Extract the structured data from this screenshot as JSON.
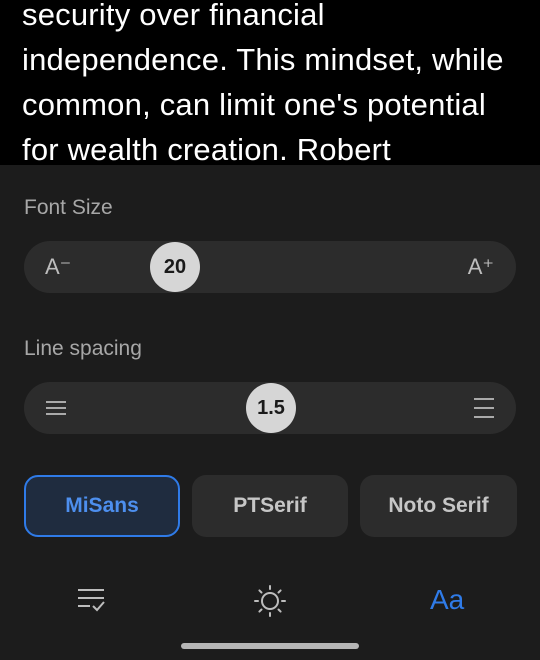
{
  "reader": {
    "lines": [
      "security over financial",
      "independence. This mindset, while",
      "common, can limit one's potential",
      "for wealth creation. Robert"
    ]
  },
  "font_size": {
    "label": "Font Size",
    "decrease_label": "A⁻",
    "increase_label": "A⁺",
    "value": "20"
  },
  "line_spacing": {
    "label": "Line spacing",
    "value": "1.5"
  },
  "fonts": {
    "options": [
      "MiSans",
      "PTSerif",
      "Noto Serif"
    ],
    "selected": "MiSans"
  },
  "bottom_nav": {
    "items": [
      {
        "icon": "table-of-contents-icon"
      },
      {
        "icon": "brightness-icon"
      },
      {
        "icon": "text-settings-icon",
        "label": "Aa",
        "active": true
      }
    ]
  },
  "colors": {
    "accent": "#2f7be8",
    "panel_bg": "#1c1c1c",
    "track_bg": "#2c2c2c",
    "reader_bg": "#000000"
  }
}
